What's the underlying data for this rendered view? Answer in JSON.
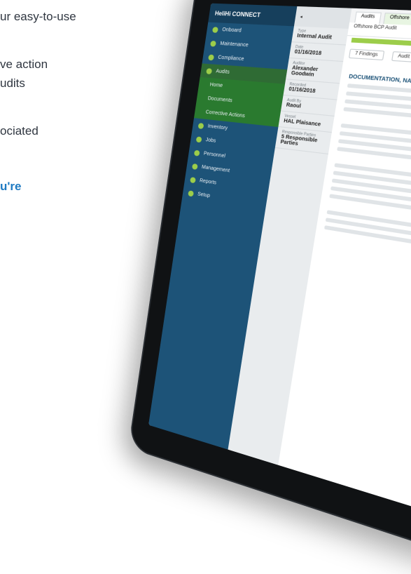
{
  "copy": {
    "line1": "ur easy-to-use",
    "line2": "ve action",
    "line3": "udits",
    "line4": "ociated",
    "line5": "u're"
  },
  "app": {
    "brand": "HeliHi CONNECT",
    "nav": [
      {
        "label": "Onboard"
      },
      {
        "label": "Maintenance"
      },
      {
        "label": "Compliance"
      },
      {
        "label": "Audits"
      },
      {
        "label": "Home"
      },
      {
        "label": "Documents"
      },
      {
        "label": "Corrective Actions"
      },
      {
        "label": "Inventory"
      },
      {
        "label": "Jobs"
      },
      {
        "label": "Personnel"
      },
      {
        "label": "Management"
      },
      {
        "label": "Reports"
      },
      {
        "label": "Setup"
      }
    ],
    "panel": {
      "fields": [
        {
          "label": "Type",
          "value": "Internal Audit"
        },
        {
          "label": "Date",
          "value": "01/16/2018"
        },
        {
          "label": "Auditor",
          "value": "Alexander Goodwin"
        },
        {
          "label": "Recorded",
          "value": "01/16/2018"
        },
        {
          "label": "Audit By",
          "value": "Raoul"
        },
        {
          "label": "Vessel",
          "value": "HAL Plaisance"
        },
        {
          "label": "Responsible Parties",
          "value": "5 Responsible Parties"
        }
      ]
    },
    "tabs": [
      "Audits",
      "Offshore"
    ],
    "crumb": "Offshore BCP Audit",
    "toolbar": {
      "findings": "7 Findings",
      "report": "Audit Report"
    },
    "section_title": "DOCUMENTATION, NAVIGATION"
  },
  "colors": {
    "nav": "#1d5378",
    "accent": "#9ccd4a",
    "link": "#1e7ac2"
  }
}
